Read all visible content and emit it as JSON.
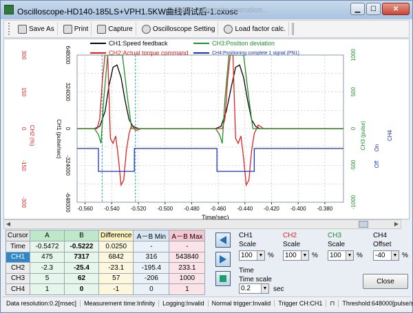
{
  "window": {
    "title": "Oscilloscope-HD140-185LS+VPH1.5KW曲线调试后-1.cxosc",
    "ghost_tabs": "Set ... | Remote operation..."
  },
  "toolbar": {
    "save_as": "Save As",
    "print": "Print",
    "capture": "Capture",
    "osc_setting": "Oscilloscope Setting",
    "load_factor": "Load factor calc."
  },
  "legend": {
    "ch1": "CH1:Speed feedback",
    "ch2": "CH2:Actual torque command",
    "ch3": "CH3:Position deviation",
    "ch4": "CH4:Positioning complete 1 signal (PN1)"
  },
  "colors": {
    "ch1": "#000000",
    "ch2": "#e02020",
    "ch3": "#1e8f2a",
    "ch4": "#1a2fb8",
    "cursor": "#2aa7a7"
  },
  "axes": {
    "xlabel": "Time(sec)",
    "x_ticks": [
      "-0.560",
      "-0.540",
      "-0.520",
      "-0.500",
      "-0.480",
      "-0.460",
      "-0.440",
      "-0.420",
      "-0.400",
      "-0.380"
    ],
    "y1_ticks": [
      "648000",
      "324000",
      "0",
      "-324000",
      "-648000"
    ],
    "y1_label": "CH1 (pulse/sec)",
    "y2_ticks": [
      "300",
      "150",
      "0",
      "-150",
      "-300"
    ],
    "y2_label": "CH2 (%)",
    "y3_ticks": [
      "1000",
      "500",
      "0",
      "-500",
      "-1000"
    ],
    "y3_label": "CH3 (pulse)",
    "y4_on": "On",
    "y4_off": "Off",
    "y4_label": "CH4"
  },
  "chart_data": {
    "type": "line",
    "xlabel": "Time(sec)",
    "xlim": [
      -0.566,
      -0.366
    ],
    "cursor_a": -0.5472,
    "cursor_b": -0.5222,
    "series": [
      {
        "name": "CH1:Speed feedback",
        "axis": "pulse/sec",
        "ylim": [
          -648000,
          648000
        ],
        "x": [
          -0.566,
          -0.553,
          -0.549,
          -0.545,
          -0.542,
          -0.539,
          -0.536,
          -0.533,
          -0.53,
          -0.527,
          -0.524,
          -0.52,
          -0.48,
          -0.462,
          -0.458,
          -0.454,
          -0.45,
          -0.447,
          -0.444,
          -0.441,
          -0.438,
          -0.435,
          -0.432,
          -0.429,
          -0.425,
          -0.366
        ],
        "y": [
          0,
          0,
          20000,
          150000,
          380000,
          540000,
          560000,
          450000,
          250000,
          80000,
          20000,
          0,
          0,
          0,
          20000,
          150000,
          380000,
          540000,
          560000,
          450000,
          250000,
          80000,
          20000,
          0,
          0,
          0
        ]
      },
      {
        "name": "CH2:Actual torque command",
        "axis": "%",
        "ylim": [
          -300,
          300
        ],
        "x": [
          -0.566,
          -0.551,
          -0.549,
          -0.547,
          -0.545,
          -0.543,
          -0.541,
          -0.539,
          -0.537,
          -0.535,
          -0.533,
          -0.531,
          -0.529,
          -0.527,
          -0.525,
          -0.522,
          -0.518,
          -0.46,
          -0.457,
          -0.455,
          -0.453,
          -0.451,
          -0.449,
          -0.447,
          -0.445,
          -0.443,
          -0.441,
          -0.439,
          -0.437,
          -0.435,
          -0.433,
          -0.43,
          -0.426,
          -0.366
        ],
        "y": [
          0,
          0,
          40,
          200,
          300,
          300,
          -40,
          -60,
          -30,
          -120,
          -230,
          -210,
          -90,
          -20,
          15,
          -8,
          0,
          0,
          0,
          40,
          200,
          300,
          300,
          -40,
          -60,
          -30,
          -120,
          -230,
          -210,
          -90,
          -20,
          15,
          0,
          0
        ]
      },
      {
        "name": "CH3:Position deviation",
        "axis": "pulse",
        "ylim": [
          -1000,
          1000
        ],
        "x": [
          -0.566,
          -0.553,
          -0.55,
          -0.548,
          -0.546,
          -0.543,
          -0.54,
          -0.536,
          -0.532,
          -0.528,
          -0.525,
          -0.52,
          -0.462,
          -0.459,
          -0.457,
          -0.455,
          -0.452,
          -0.449,
          -0.445,
          -0.441,
          -0.437,
          -0.434,
          -0.366
        ],
        "y": [
          0,
          0,
          -80,
          -200,
          400,
          1000,
          1000,
          1000,
          1000,
          400,
          0,
          0,
          0,
          -80,
          -200,
          400,
          1000,
          1000,
          1000,
          1000,
          400,
          0,
          0
        ]
      },
      {
        "name": "CH4:Positioning complete 1 signal (PN1)",
        "axis": "On/Off",
        "ylim": [
          0,
          1
        ],
        "x": [
          -0.566,
          -0.55,
          -0.55,
          -0.523,
          -0.523,
          -0.461,
          -0.461,
          -0.433,
          -0.433,
          -0.366
        ],
        "y": [
          1,
          1,
          0,
          0,
          1,
          1,
          0,
          0,
          1,
          1
        ]
      }
    ]
  },
  "cursor_table": {
    "headers": [
      "Cursor",
      "A",
      "B",
      "Difference",
      "A－B Min",
      "A－B Max"
    ],
    "rows": [
      {
        "label": "Time",
        "a": "-0.5472",
        "b": "-0.5222",
        "diff": "0.0250",
        "min": "-",
        "max": "-"
      },
      {
        "label": "CH1",
        "a": "475",
        "b": "7317",
        "diff": "6842",
        "min": "316",
        "max": "543840"
      },
      {
        "label": "CH2",
        "a": "-2.3",
        "b": "-25.4",
        "diff": "-23.1",
        "min": "-195.4",
        "max": "233.1"
      },
      {
        "label": "CH3",
        "a": "5",
        "b": "62",
        "diff": "57",
        "min": "-206",
        "max": "1000"
      },
      {
        "label": "CH4",
        "a": "1",
        "b": "0",
        "diff": "-1",
        "min": "0",
        "max": "1"
      }
    ]
  },
  "controls": {
    "ch1": {
      "title": "CH1",
      "sub": "Scale",
      "value": "100",
      "unit": "%"
    },
    "ch2": {
      "title": "CH2",
      "sub": "Scale",
      "value": "100",
      "unit": "%"
    },
    "ch3": {
      "title": "CH3",
      "sub": "Scale",
      "value": "100",
      "unit": "%"
    },
    "ch4": {
      "title": "CH4",
      "sub": "Offset",
      "value": "-40",
      "unit": "%"
    },
    "time": {
      "title": "Time",
      "sub": "Time scale",
      "value": "0.2",
      "unit": "sec"
    },
    "close": "Close"
  },
  "status": {
    "resolution": "Data resolution:0.2[msec]",
    "measurement": "Measurement time:Infinity",
    "logging": "Logging:Invalid",
    "normal_trigger": "Normal trigger:Invalid",
    "trigger": "Trigger CH:CH1",
    "threshold": "Threshold:648000[pulse/sec]"
  }
}
